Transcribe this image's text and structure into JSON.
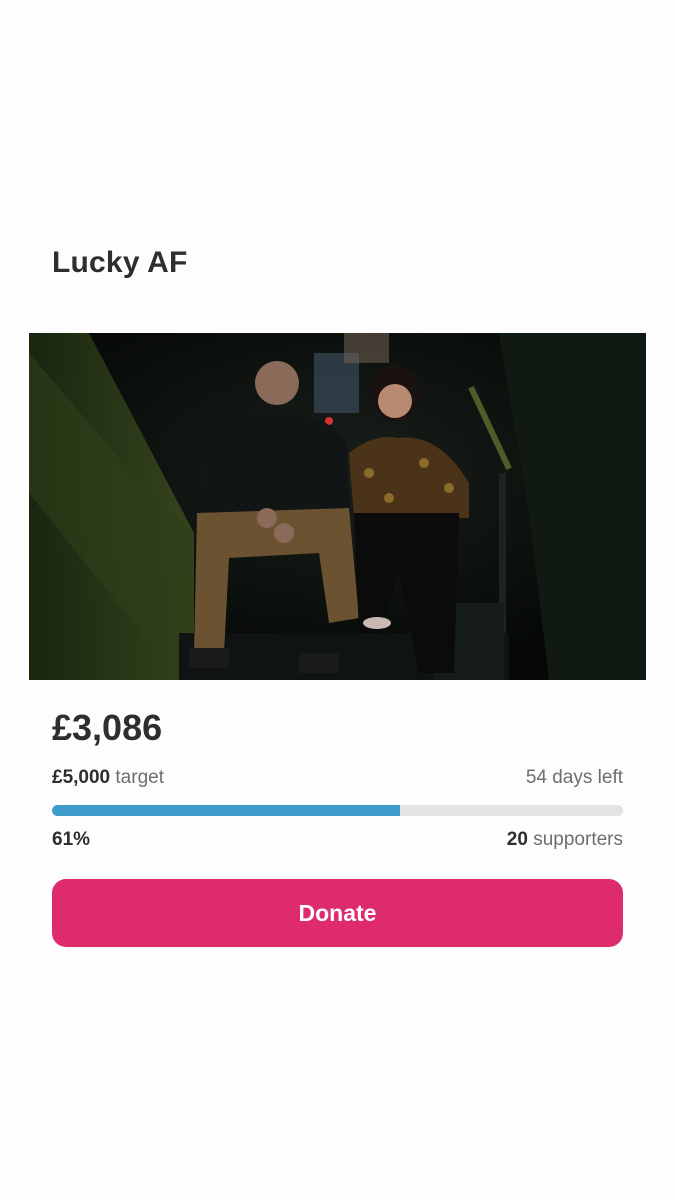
{
  "campaign": {
    "title": "Lucky AF",
    "image_alt": "Two people sitting on dark stairs",
    "raised": "£3,086",
    "target_amount": "£5,000",
    "target_label": "target",
    "days_left": "54 days left",
    "percent_label": "61%",
    "progress_fraction": 0.61,
    "supporters_count": "20",
    "supporters_label": "supporters"
  },
  "actions": {
    "donate_label": "Donate"
  },
  "colors": {
    "accent": "#de2b6d",
    "progress": "#3d9ccc",
    "track": "#e3e3e3"
  }
}
